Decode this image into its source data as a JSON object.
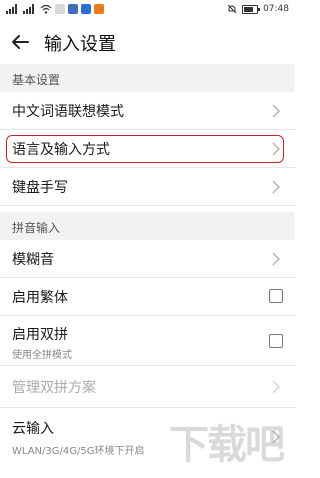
{
  "status_bar": {
    "time": "07:48",
    "battery_icon": "battery-icon",
    "mute_icon": "mute-icon"
  },
  "header": {
    "title": "输入设置",
    "back_icon": "back-arrow-icon"
  },
  "sections": {
    "basic": {
      "title": "基本设置",
      "items": [
        {
          "label": "中文词语联想模式",
          "control": "chevron"
        },
        {
          "label": "语言及输入方式",
          "control": "chevron",
          "highlighted": true
        },
        {
          "label": "键盘手写",
          "control": "chevron"
        }
      ]
    },
    "pinyin": {
      "title": "拼音输入",
      "items": [
        {
          "label": "模糊音",
          "control": "chevron"
        },
        {
          "label": "启用繁体",
          "control": "checkbox",
          "checked": false
        },
        {
          "label": "启用双拼",
          "subtitle": "使用全拼模式",
          "control": "checkbox",
          "checked": false
        },
        {
          "label": "管理双拼方案",
          "control": "chevron",
          "disabled": true
        },
        {
          "label": "云输入",
          "subtitle": "WLAN/3G/4G/5G环境下开启",
          "control": "chevron"
        }
      ]
    }
  },
  "colors": {
    "highlight": "#c0242c",
    "section_bg": "#f2f2f2"
  },
  "watermark_text": "下载吧"
}
